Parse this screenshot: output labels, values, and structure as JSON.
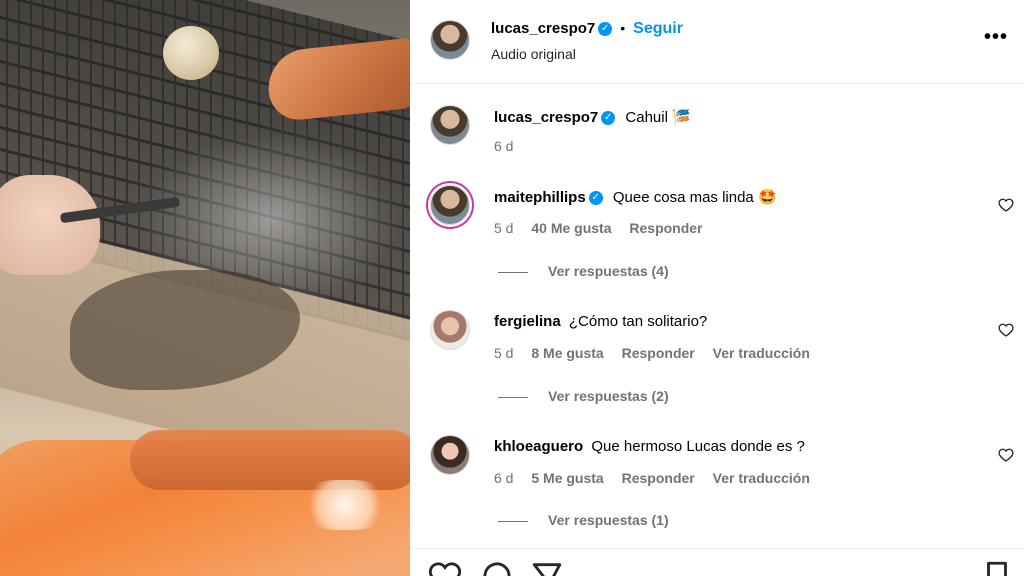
{
  "header": {
    "username": "lucas_crespo7",
    "separator": "•",
    "follow_label": "Seguir",
    "audio_label": "Audio original",
    "more_label": "•••"
  },
  "caption": {
    "username": "lucas_crespo7",
    "text": "Cahuil",
    "emoji": "🎏",
    "time": "6 d"
  },
  "comments": [
    {
      "username": "maitephillips",
      "verified": true,
      "text": "Quee cosa mas linda 🤩",
      "time": "5 d",
      "likes": "40 Me gusta",
      "reply_label": "Responder",
      "view_replies": "Ver respuestas (4)"
    },
    {
      "username": "fergielina",
      "verified": false,
      "text": "¿Cómo tan solitario?",
      "time": "5 d",
      "likes": "8 Me gusta",
      "reply_label": "Responder",
      "translate_label": "Ver traducción",
      "view_replies": "Ver respuestas (2)"
    },
    {
      "username": "khloeaguero",
      "verified": false,
      "text": "Que hermoso Lucas donde es ?",
      "time": "6 d",
      "likes": "5 Me gusta",
      "reply_label": "Responder",
      "translate_label": "Ver traducción",
      "view_replies": "Ver respuestas (1)"
    }
  ],
  "icons": {
    "verified": "verified-badge-icon",
    "like": "heart-icon",
    "comment": "comment-icon",
    "share": "paper-plane-icon",
    "save": "bookmark-icon"
  },
  "colors": {
    "accent": "#0095f6",
    "muted": "#737373"
  }
}
